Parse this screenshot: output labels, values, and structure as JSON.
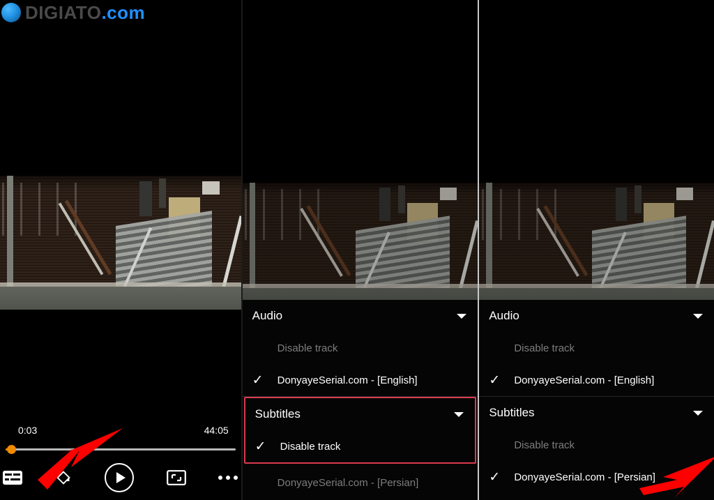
{
  "watermark": {
    "name_dark": "DIGIATO",
    "name_blue": ".com"
  },
  "player": {
    "current_time": "0:03",
    "duration": "44:05",
    "progress_percent": 1,
    "accent_color": "#f08a00",
    "controls": [
      {
        "name": "subtitle-toggle",
        "icon": "closed-caption-icon",
        "label": "Subtitles"
      },
      {
        "name": "orientation-lock",
        "icon": "rotate-icon",
        "label": "Rotate"
      },
      {
        "name": "play-button",
        "icon": "play-icon",
        "label": "Play"
      },
      {
        "name": "aspect-fit",
        "icon": "fit-screen-icon",
        "label": "Fit screen"
      },
      {
        "name": "more-options",
        "icon": "more-dots-icon",
        "label": "More"
      }
    ]
  },
  "menu_middle": {
    "highlight_color": "#d93b4e",
    "sections": [
      {
        "title": "Audio",
        "caret": "chevron-down-icon",
        "highlighted": false,
        "options": [
          {
            "label": "Disable track",
            "checked": false,
            "dim": true
          },
          {
            "label": "DonyayeSerial.com - [English]",
            "checked": true,
            "dim": false
          }
        ]
      },
      {
        "title": "Subtitles",
        "caret": "chevron-down-icon",
        "highlighted": true,
        "options": [
          {
            "label": "Disable track",
            "checked": true,
            "dim": false
          },
          {
            "label": "DonyayeSerial.com - [Persian]",
            "checked": false,
            "dim": true
          }
        ]
      }
    ]
  },
  "menu_right": {
    "highlight_color": "#d93b4e",
    "sections": [
      {
        "title": "Audio",
        "caret": "chevron-down-icon",
        "highlighted": false,
        "options": [
          {
            "label": "Disable track",
            "checked": false,
            "dim": true
          },
          {
            "label": "DonyayeSerial.com - [English]",
            "checked": true,
            "dim": false
          }
        ]
      },
      {
        "title": "Subtitles",
        "caret": "chevron-down-icon",
        "highlighted": false,
        "options": [
          {
            "label": "Disable track",
            "checked": false,
            "dim": true
          },
          {
            "label": "DonyayeSerial.com - [Persian]",
            "checked": true,
            "dim": false
          }
        ]
      }
    ]
  },
  "annotations": [
    {
      "name": "arrow-to-subtitle-button",
      "color": "#ff0000",
      "points_to": "subtitle-toggle"
    },
    {
      "name": "arrow-to-persian-subtitle",
      "color": "#ff0000",
      "points_to": "persian-subtitle-option"
    }
  ]
}
